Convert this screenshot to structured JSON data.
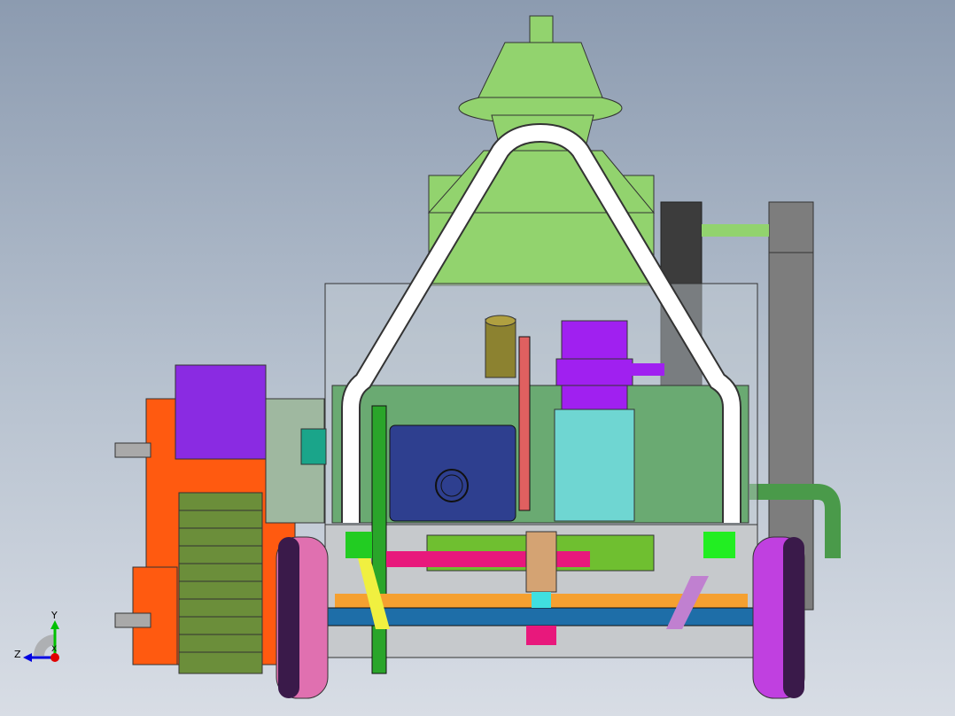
{
  "viewport": {
    "background_top": "#8c9bb0",
    "background_bottom": "#d8dde5",
    "model": "cad-assembly-machine"
  },
  "triad": {
    "axis_y": "Y",
    "axis_z": "Z",
    "axis_x": "X",
    "color_y": "#00c000",
    "color_z": "#0000e0",
    "color_x": "#e00000"
  },
  "colors": {
    "hopper_green": "#92d36e",
    "frame_white": "#ffffff",
    "orange_housing": "#ff5a10",
    "purple_block": "#8a2be2",
    "olive_tread": "#6b8e3a",
    "navy_motor": "#2e3f8f",
    "cyan_box": "#6fd6d2",
    "magenta_gearbox": "#a020f0",
    "pink_wheel": "#e070b0",
    "dark_post": "#3a3a3a",
    "gray_post": "#7a7a7a",
    "blue_axle": "#1e6ea8",
    "orange_bar": "#f5a030",
    "rose_bar": "#e8187c",
    "bright_green": "#22ee22"
  }
}
